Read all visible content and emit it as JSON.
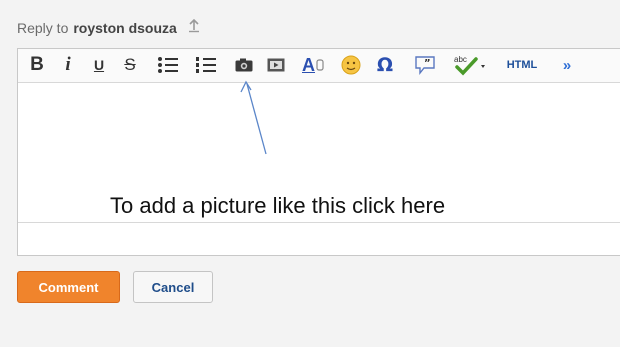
{
  "reply": {
    "prefix": "Reply to",
    "username": "royston dsouza",
    "icon": "reply-up-icon"
  },
  "toolbar": {
    "bold": "B",
    "italic": "i",
    "underline": "U",
    "strike": "S",
    "text_color_letter": "A",
    "omega": "Ω",
    "spell_label": "abc",
    "html": "HTML",
    "more": "»",
    "icons": [
      "bold-icon",
      "italic-icon",
      "underline-icon",
      "strikethrough-icon",
      "bulleted-list-icon",
      "numbered-list-icon",
      "camera-icon",
      "video-icon",
      "text-color-icon",
      "emoji-icon",
      "special-character-icon",
      "quote-icon",
      "spellcheck-icon",
      "html-mode-icon",
      "more-icon"
    ]
  },
  "editor": {
    "annotation": "To add a picture like this click here"
  },
  "buttons": {
    "comment": "Comment",
    "cancel": "Cancel"
  },
  "colors": {
    "comment_bg": "#f0842c",
    "cancel_text": "#1f4d8a",
    "arrow": "#5b86c9",
    "spell_check": "#4a9a2a"
  }
}
